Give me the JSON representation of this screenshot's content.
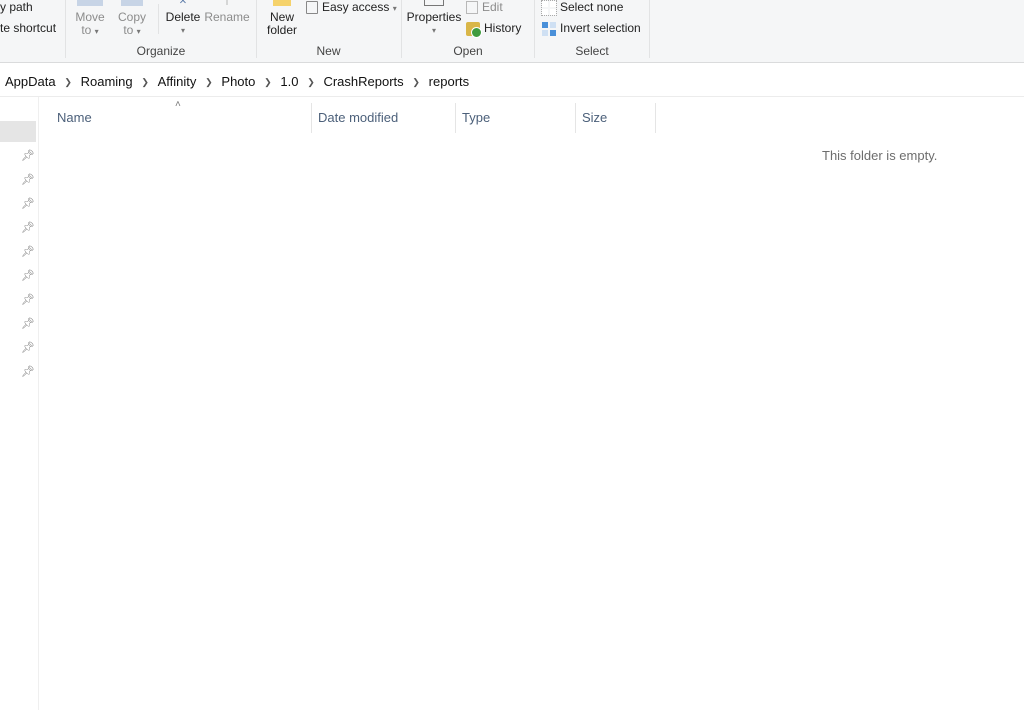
{
  "ribbon": {
    "clipboard": {
      "copy_path": "y path",
      "paste_shortcut": "te shortcut"
    },
    "organize": {
      "label": "Organize",
      "move_to": [
        "Move",
        "to"
      ],
      "copy_to": [
        "Copy",
        "to"
      ],
      "delete": "Delete",
      "rename": "Rename"
    },
    "new": {
      "label": "New",
      "new_folder": [
        "New",
        "folder"
      ],
      "easy_access": "Easy access"
    },
    "open": {
      "label": "Open",
      "properties": "Properties",
      "edit": "Edit",
      "history": "History"
    },
    "select": {
      "label": "Select",
      "select_none": "Select none",
      "invert_selection": "Invert selection"
    }
  },
  "breadcrumb": [
    "AppData",
    "Roaming",
    "Affinity",
    "Photo",
    "1.0",
    "CrashReports",
    "reports"
  ],
  "columns": [
    "Name",
    "Date modified",
    "Type",
    "Size"
  ],
  "empty_message": "This folder is empty."
}
